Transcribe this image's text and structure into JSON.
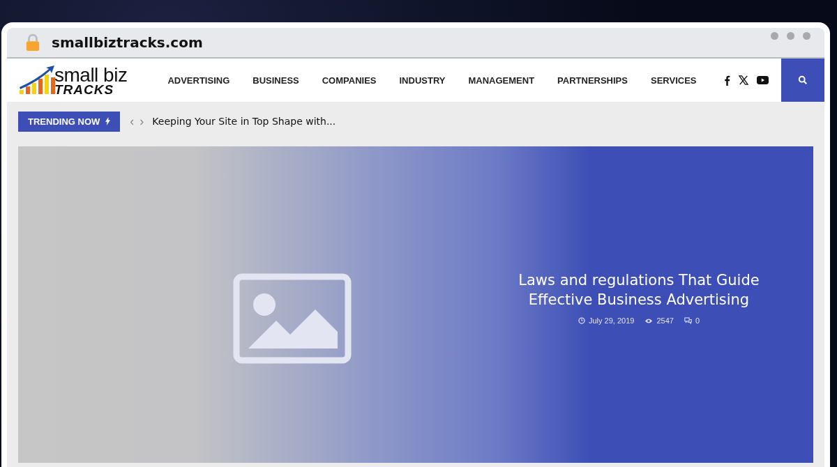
{
  "browser": {
    "url": "smallbiztracks.com"
  },
  "logo": {
    "line1": "small biz",
    "line2": "TRACKS"
  },
  "nav": [
    "ADVERTISING",
    "BUSINESS",
    "COMPANIES",
    "INDUSTRY",
    "MANAGEMENT",
    "PARTNERSHIPS",
    "SERVICES"
  ],
  "trending": {
    "label": "TRENDING NOW",
    "prev": "‹",
    "next": "›",
    "headline": "Keeping Your Site in Top Shape with..."
  },
  "hero": {
    "title": "Laws and regulations That Guide Effective Business Advertising",
    "date": "July 29, 2019",
    "views": "2547",
    "comments": "0"
  }
}
